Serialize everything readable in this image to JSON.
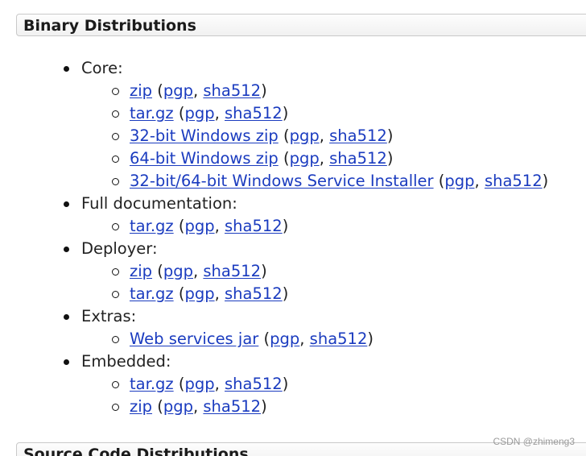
{
  "sections": {
    "binary_title": "Binary Distributions",
    "source_title": "Source Code Distributions"
  },
  "groups": [
    {
      "label": "Core:",
      "items": [
        {
          "name": "zip",
          "sig": "pgp",
          "hash": "sha512"
        },
        {
          "name": "tar.gz",
          "sig": "pgp",
          "hash": "sha512"
        },
        {
          "name": "32-bit Windows zip",
          "sig": "pgp",
          "hash": "sha512"
        },
        {
          "name": "64-bit Windows zip",
          "sig": "pgp",
          "hash": "sha512"
        },
        {
          "name": "32-bit/64-bit Windows Service Installer",
          "sig": "pgp",
          "hash": "sha512"
        }
      ]
    },
    {
      "label": "Full documentation:",
      "items": [
        {
          "name": "tar.gz",
          "sig": "pgp",
          "hash": "sha512"
        }
      ]
    },
    {
      "label": "Deployer:",
      "items": [
        {
          "name": "zip",
          "sig": "pgp",
          "hash": "sha512"
        },
        {
          "name": "tar.gz",
          "sig": "pgp",
          "hash": "sha512"
        }
      ]
    },
    {
      "label": "Extras:",
      "items": [
        {
          "name": "Web services jar",
          "sig": "pgp",
          "hash": "sha512"
        }
      ]
    },
    {
      "label": "Embedded:",
      "items": [
        {
          "name": "tar.gz",
          "sig": "pgp",
          "hash": "sha512"
        },
        {
          "name": "zip",
          "sig": "pgp",
          "hash": "sha512"
        }
      ]
    }
  ],
  "punct": {
    "open": " (",
    "sep": ", ",
    "close": ")"
  },
  "watermark": "CSDN @zhimeng3"
}
